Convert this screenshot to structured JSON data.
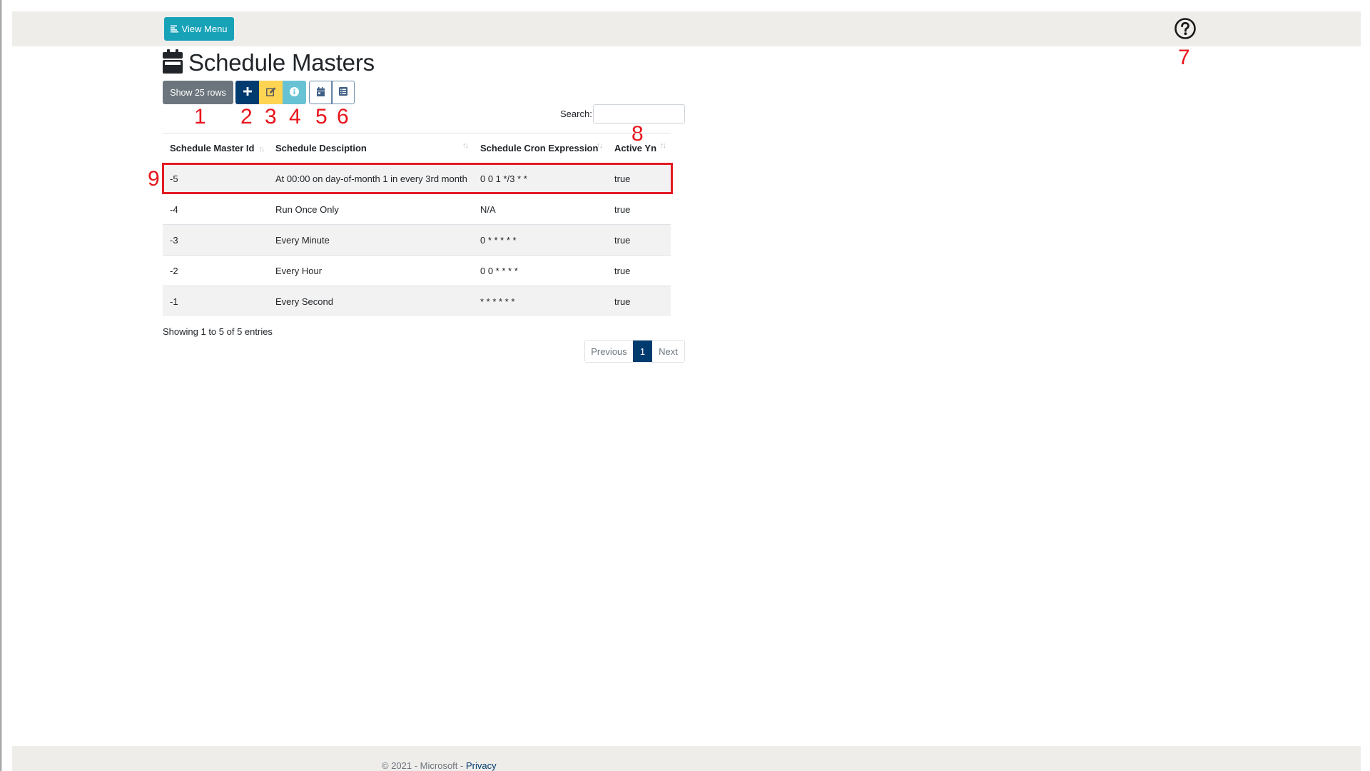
{
  "header": {
    "view_menu_label": "View Menu",
    "help_icon": "question-circle-icon"
  },
  "page": {
    "title": "Schedule Masters",
    "title_icon": "calendar-icon"
  },
  "toolbar": {
    "rows_label": "Show 25 rows",
    "buttons": [
      {
        "name": "add",
        "icon": "plus-icon",
        "color": "#003b6f"
      },
      {
        "name": "edit",
        "icon": "edit-icon",
        "color": "#ffd453"
      },
      {
        "name": "info",
        "icon": "info-circle-icon",
        "color": "#67c2d4"
      },
      {
        "name": "calendar",
        "icon": "calendar-icon",
        "color": "#ffffff"
      },
      {
        "name": "list",
        "icon": "list-icon",
        "color": "#ffffff"
      }
    ]
  },
  "search": {
    "label": "Search:",
    "value": "",
    "placeholder": ""
  },
  "table": {
    "columns": [
      {
        "label": "Schedule Master Id",
        "sort_icon": "↑↓"
      },
      {
        "label": "Schedule Desciption",
        "sort_icon": "↑↓"
      },
      {
        "label": "Schedule Cron Expression",
        "sort_icon": "↑↓"
      },
      {
        "label": "Active Yn",
        "sort_icon": "↑↓"
      }
    ],
    "rows": [
      {
        "id": "-5",
        "description": "At 00:00 on day-of-month 1 in every 3rd month",
        "cron": "0 0 1 */3 * *",
        "active": "true"
      },
      {
        "id": "-4",
        "description": "Run Once Only",
        "cron": "N/A",
        "active": "true"
      },
      {
        "id": "-3",
        "description": "Every Minute",
        "cron": "0 * * * * *",
        "active": "true"
      },
      {
        "id": "-2",
        "description": "Every Hour",
        "cron": "0 0 * * * *",
        "active": "true"
      },
      {
        "id": "-1",
        "description": "Every Second",
        "cron": "* * * * * *",
        "active": "true"
      }
    ],
    "info": "Showing 1 to 5 of 5 entries"
  },
  "pagination": {
    "previous": "Previous",
    "current": "1",
    "next": "Next"
  },
  "annotations": {
    "labels": [
      "1",
      "2",
      "3",
      "4",
      "5",
      "6",
      "7",
      "8",
      "9"
    ],
    "color": "#e8141b",
    "highlight_color": "#e31b23"
  },
  "footer": {
    "copyright": "© 2021 - Microsoft - ",
    "privacy_link": "Privacy"
  }
}
